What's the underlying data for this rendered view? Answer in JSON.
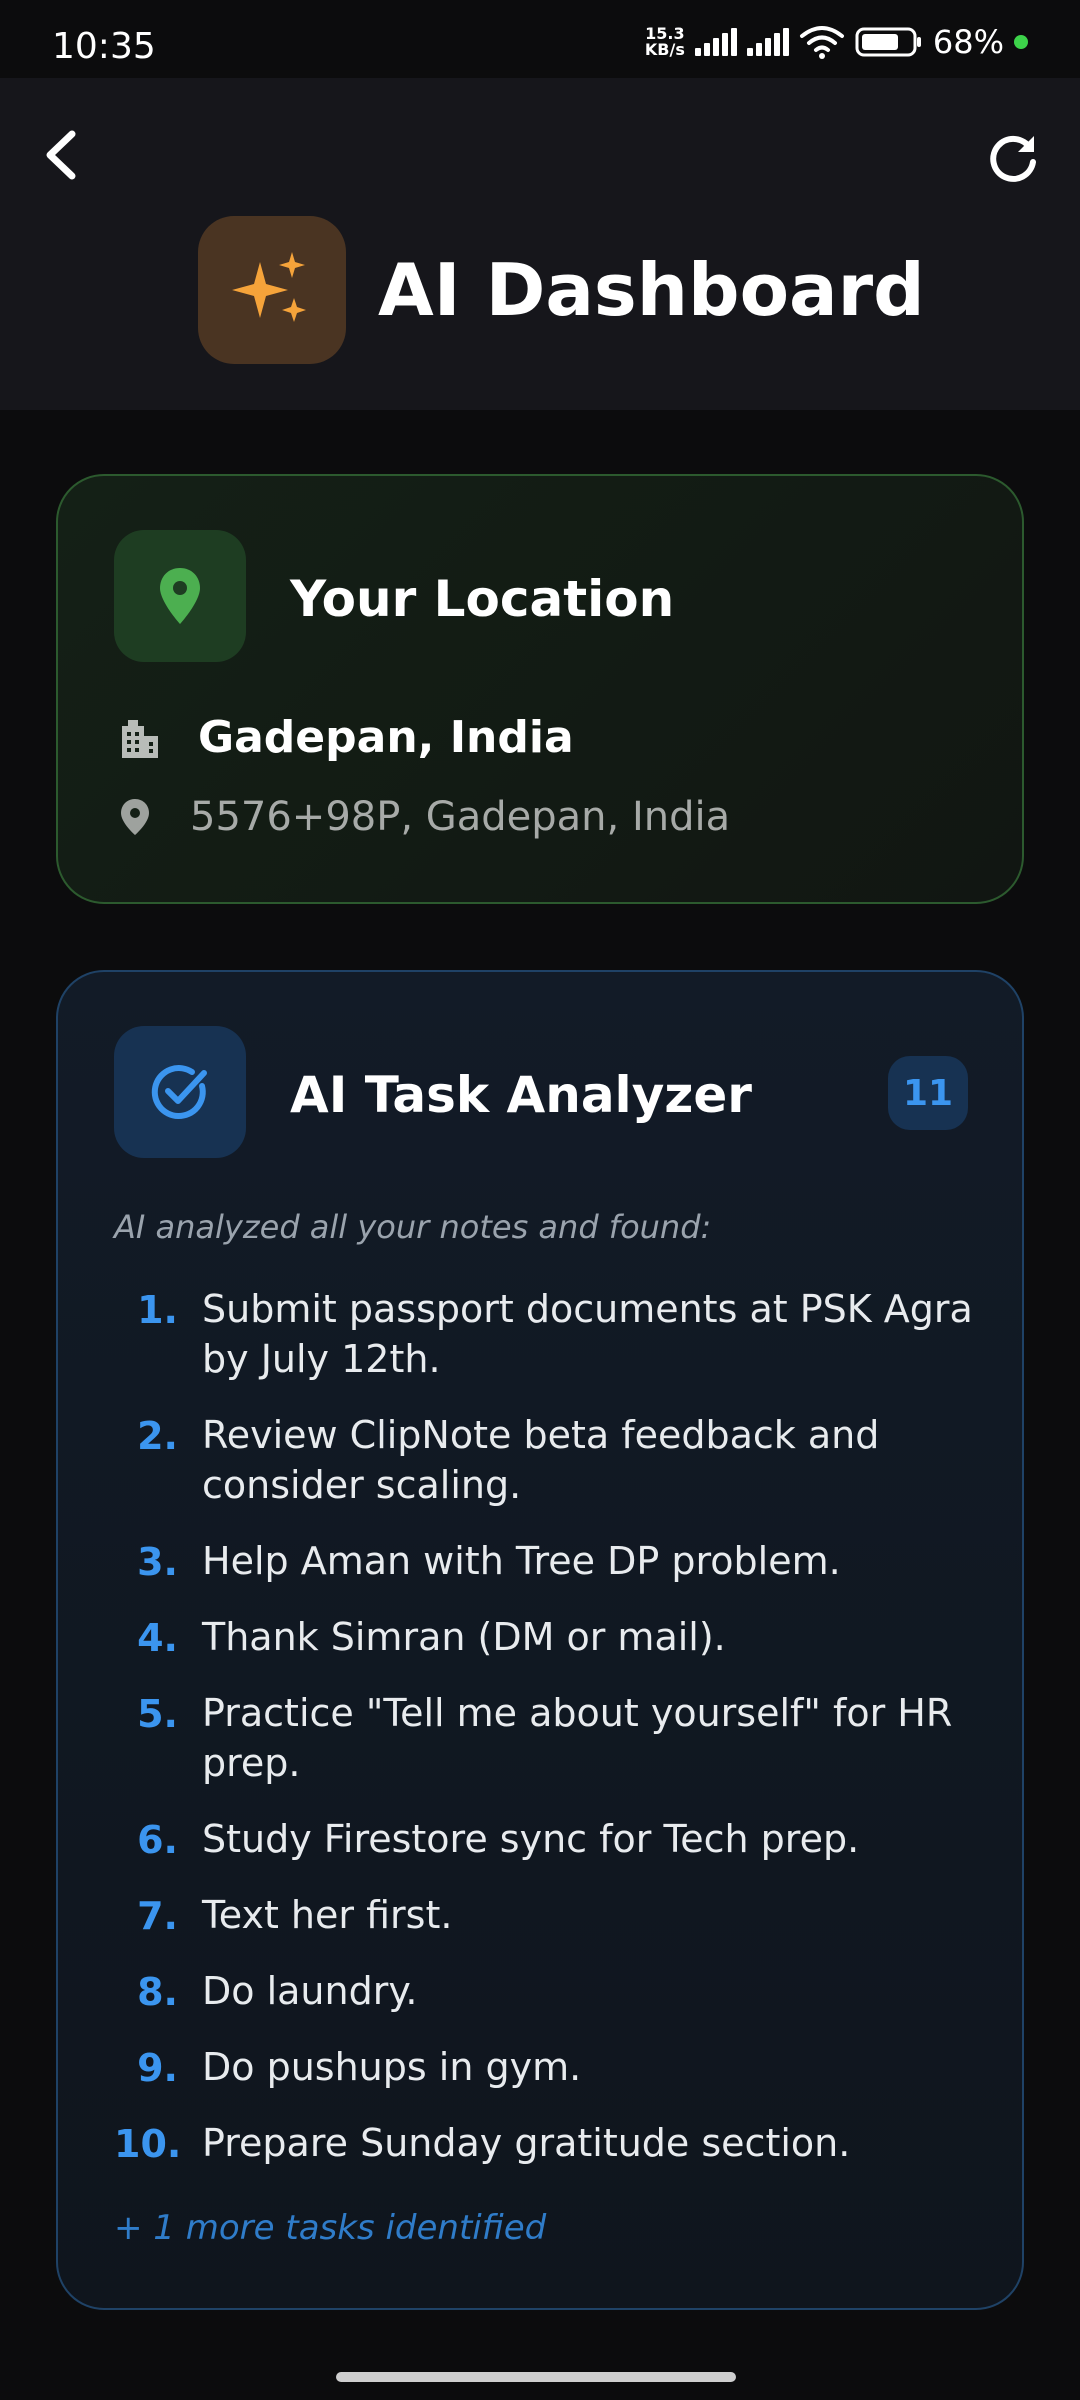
{
  "status_bar": {
    "time": "10:35",
    "net_speed_value": "15.3",
    "net_speed_unit": "KB/s",
    "battery": "68%"
  },
  "header": {
    "title": "AI Dashboard"
  },
  "location_card": {
    "title": "Your Location",
    "city": "Gadepan, India",
    "address": "5576+98P, Gadepan, India"
  },
  "task_card": {
    "title": "AI Task Analyzer",
    "count": "11",
    "intro": "AI analyzed all your notes and found:",
    "tasks": [
      {
        "num": "1.",
        "text": "Submit passport documents at PSK Agra by July 12th."
      },
      {
        "num": "2.",
        "text": "Review ClipNote beta feedback and consider scaling."
      },
      {
        "num": "3.",
        "text": "Help Aman with Tree DP problem."
      },
      {
        "num": "4.",
        "text": "Thank Simran (DM or mail)."
      },
      {
        "num": "5.",
        "text": "Practice \"Tell me about yourself\" for HR prep."
      },
      {
        "num": "6.",
        "text": "Study Firestore sync for Tech prep."
      },
      {
        "num": "7.",
        "text": "Text her first."
      },
      {
        "num": "8.",
        "text": "Do laundry."
      },
      {
        "num": "9.",
        "text": "Do pushups in gym."
      },
      {
        "num": "10.",
        "text": "Prepare Sunday gratitude section."
      }
    ],
    "more": "+ 1 more tasks identified"
  },
  "icons": {
    "back": "back-arrow-icon",
    "refresh": "refresh-icon",
    "logo": "sparkles-icon",
    "location": "map-pin-icon",
    "city": "building-icon",
    "address": "place-icon",
    "tasks": "check-circle-icon"
  },
  "colors": {
    "accent_green": "#4caf50",
    "accent_blue": "#3b95ef",
    "accent_orange": "#f5a33a"
  }
}
